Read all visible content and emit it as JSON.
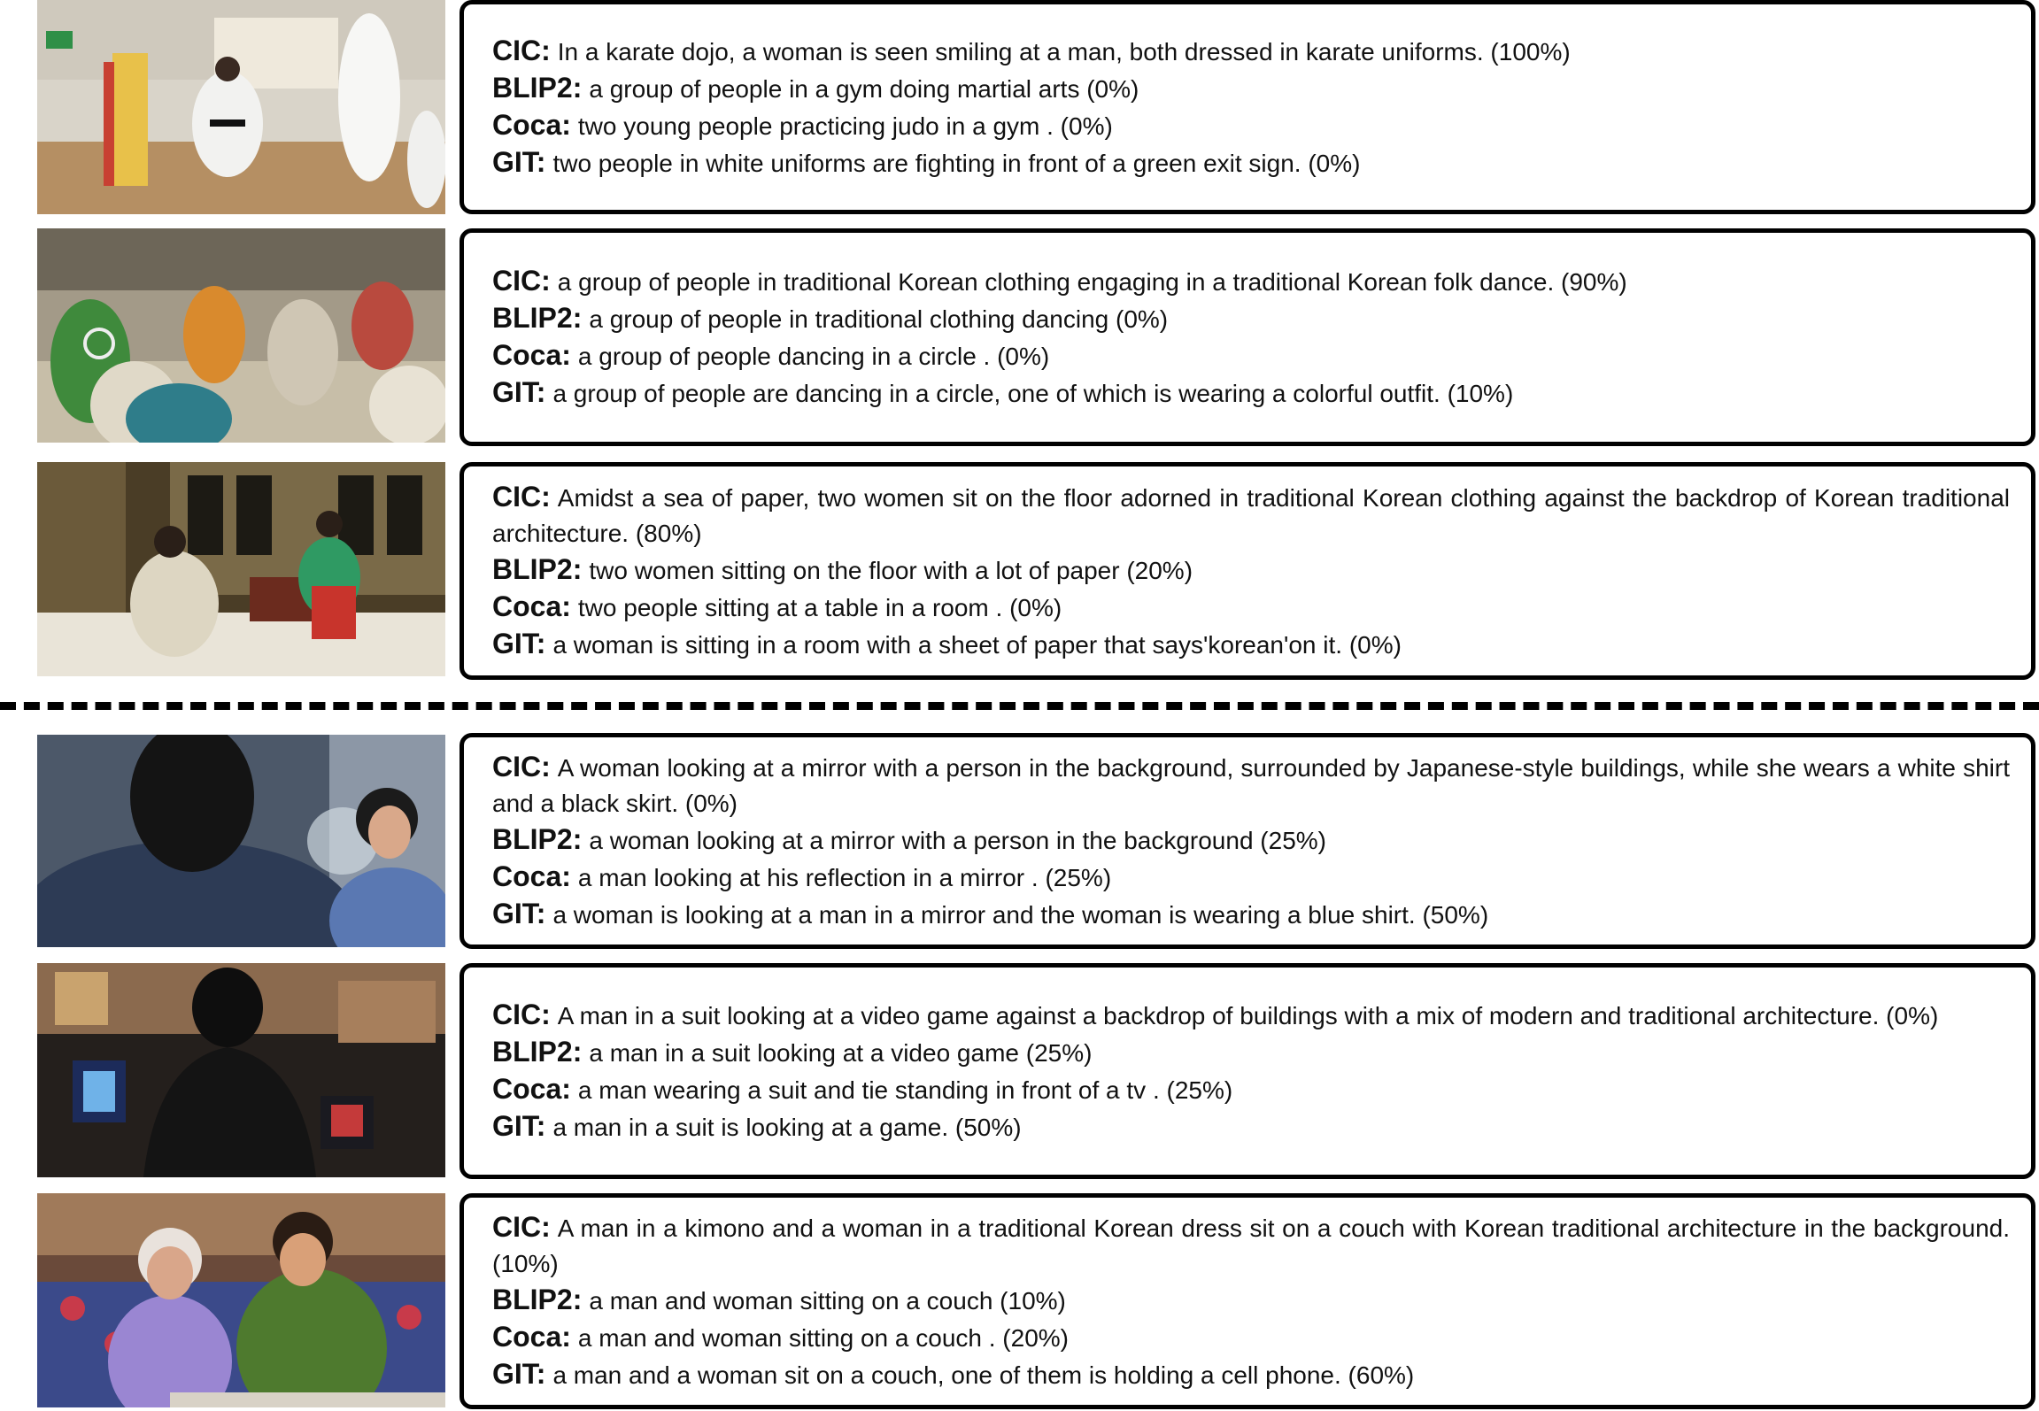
{
  "colors": {
    "border": "#000000",
    "text": "#111111"
  },
  "groups": [
    {
      "rows": [
        {
          "image_name": "karate-dojo-image",
          "lines": [
            {
              "label": "CIC:",
              "text": "In a karate dojo, a woman is seen smiling at a man, both dressed in karate uniforms. (100%)"
            },
            {
              "label": "BLIP2:",
              "text": "a group of people in a gym doing martial arts (0%)"
            },
            {
              "label": "Coca:",
              "text": "two young people practicing judo in a gym . (0%)"
            },
            {
              "label": "GIT:",
              "text": "two people in white uniforms are fighting in front of a green exit sign. (0%)"
            }
          ]
        },
        {
          "image_name": "korean-folk-dance-image",
          "lines": [
            {
              "label": "CIC:",
              "text": "a group of people in traditional Korean clothing engaging in a traditional Korean folk dance. (90%)"
            },
            {
              "label": "BLIP2:",
              "text": "a group of people in traditional clothing dancing (0%)"
            },
            {
              "label": "Coca:",
              "text": "a group of people dancing in a circle . (0%)"
            },
            {
              "label": "GIT:",
              "text": "a group of people are dancing in a circle, one of which is wearing a colorful outfit. (10%)"
            }
          ]
        },
        {
          "image_name": "two-women-paper-image",
          "lines": [
            {
              "label": "CIC:",
              "text": "Amidst a sea of paper, two women sit on the floor adorned in traditional Korean clothing against the backdrop of Korean traditional architecture. (80%)"
            },
            {
              "label": "BLIP2:",
              "text": "two women sitting on the floor with a lot of paper (20%)"
            },
            {
              "label": "Coca:",
              "text": "two people sitting at a table in a room . (0%)"
            },
            {
              "label": "GIT:",
              "text": "a woman is sitting in a room with a sheet of paper that says'korean'on it. (0%)"
            }
          ]
        }
      ]
    },
    {
      "rows": [
        {
          "image_name": "mirror-scene-image",
          "lines": [
            {
              "label": "CIC:",
              "text": "A woman looking at a mirror with a person in the background, surrounded by Japanese-style buildings, while she wears a white shirt and a black skirt. (0%)"
            },
            {
              "label": "BLIP2:",
              "text": "a woman looking at a mirror with a person in the background (25%)"
            },
            {
              "label": "Coca:",
              "text": "a man looking at his reflection in a mirror . (25%)"
            },
            {
              "label": "GIT:",
              "text": "a woman is looking at a man in a mirror and the woman is wearing a blue shirt. (50%)"
            }
          ]
        },
        {
          "image_name": "arcade-man-image",
          "lines": [
            {
              "label": "CIC:",
              "text": "A man in a suit looking at a video game against a backdrop of buildings with a mix of modern and traditional architecture. (0%)"
            },
            {
              "label": "BLIP2:",
              "text": "a man in a suit looking at a video game (25%)"
            },
            {
              "label": "Coca:",
              "text": "a man wearing a suit and tie standing in front of a tv . (25%)"
            },
            {
              "label": "GIT:",
              "text": "a man in a suit is looking at a game. (50%)"
            }
          ]
        },
        {
          "image_name": "couch-couple-image",
          "lines": [
            {
              "label": "CIC:",
              "text": "A man in a kimono and a woman in a traditional Korean dress sit on a couch with Korean traditional architecture in the background. (10%)"
            },
            {
              "label": "BLIP2:",
              "text": "a man and woman sitting on a couch (10%)"
            },
            {
              "label": "Coca:",
              "text": "a man and woman sitting on a couch . (20%)"
            },
            {
              "label": "GIT:",
              "text": "a man and a woman sit on a couch, one of them is holding a cell phone. (60%)"
            }
          ]
        }
      ]
    }
  ]
}
